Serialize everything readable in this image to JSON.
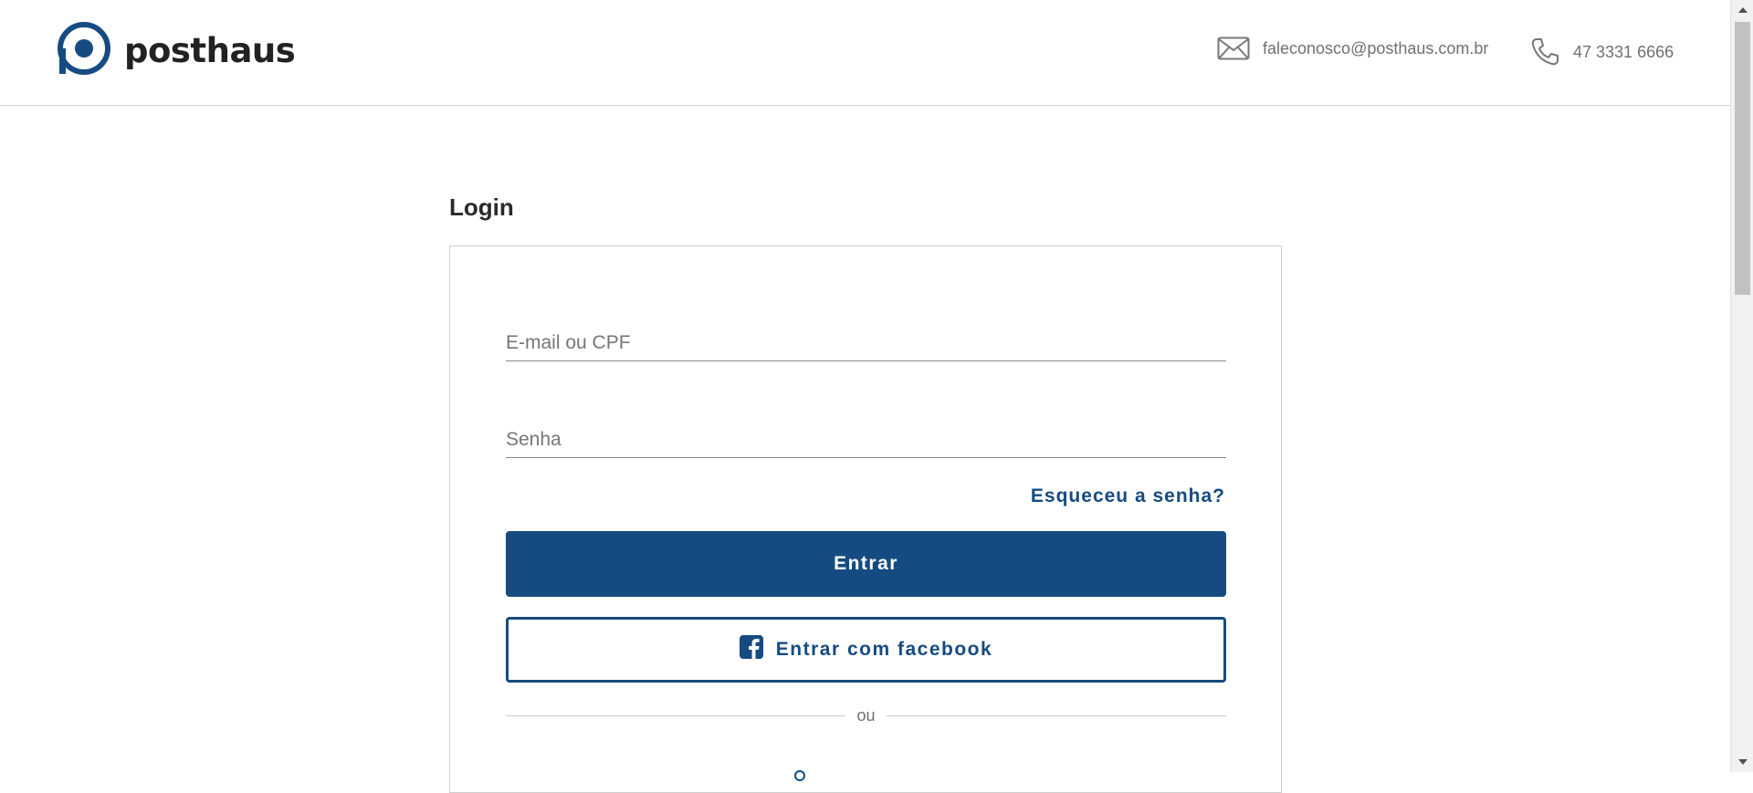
{
  "header": {
    "logo_text": "posthaus",
    "email": "faleconosco@posthaus.com.br",
    "phone": "47 3331 6666"
  },
  "colors": {
    "brand": "#164b82",
    "text": "#333333",
    "muted": "#707070",
    "border": "#cfcfcf"
  },
  "login": {
    "title": "Login",
    "email_placeholder": "E-mail ou CPF",
    "email_value": "",
    "password_placeholder": "Senha",
    "password_value": "",
    "forgot_label": "Esqueceu a senha?",
    "submit_label": "Entrar",
    "facebook_label": "Entrar com facebook",
    "divider_text": "ou"
  },
  "icons": {
    "logo": "posthaus-logo-icon",
    "email": "envelope-icon",
    "phone": "phone-icon",
    "facebook": "facebook-icon"
  }
}
